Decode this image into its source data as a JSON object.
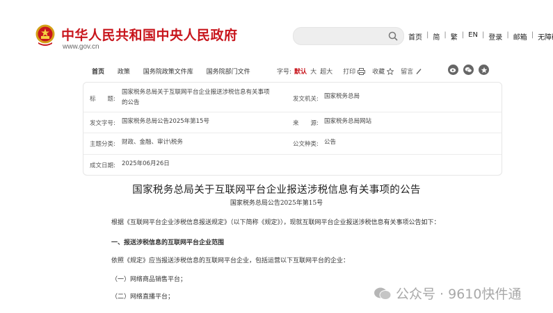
{
  "header": {
    "site_title": "中华人民共和国中央人民政府",
    "site_url": "www.gov.cn",
    "search_placeholder": "",
    "links": [
      "首页",
      "简",
      "繁",
      "EN",
      "登录",
      "邮箱",
      "无障碍"
    ]
  },
  "nav": {
    "breadcrumbs": [
      "首页",
      "政策",
      "国务院政策文件库",
      "国务院部门文件"
    ],
    "font_size_label": "字号:",
    "font_sizes": [
      "默认",
      "大",
      "超大"
    ],
    "print_label": "打印",
    "collect_label": "收藏",
    "comment_label": "留言"
  },
  "meta": {
    "title_key": "标　　题:",
    "title_value": "国家税务总局关于互联网平台企业报送涉税信息有关事项的公告",
    "issuer_key": "发文机关:",
    "issuer_value": "国家税务总局",
    "docno_key": "发文字号:",
    "docno_value": "国家税务总局公告2025年第15号",
    "source_key": "来　　源:",
    "source_value": "国家税务总局网站",
    "subject_key": "主题分类:",
    "subject_value": "财政、金融、审计\\税务",
    "doctype_key": "公文种类:",
    "doctype_value": "公告",
    "date_key": "成文日期:",
    "date_value": "2025年06月26日"
  },
  "document": {
    "title": "国家税务总局关于互联网平台企业报送涉税信息有关事项的公告",
    "number": "国家税务总局公告2025年第15号",
    "intro": "根据《互联网平台企业涉税信息报送规定》（以下简称《规定》），现就互联网平台企业报送涉税信息有关事项公告如下：",
    "section1": "一、报送涉税信息的互联网平台企业范围",
    "section1_text": "依照《规定》应当报送涉税信息的互联网平台企业，包括运营以下互联网平台的企业：",
    "item1": "（一）网络商品销售平台；",
    "item2": "（二）网络直播平台；"
  },
  "watermark": {
    "text": "公众号 · 9610快件通"
  },
  "colors": {
    "brand_red": "#c8161d",
    "meta_border": "#e6e6e6"
  }
}
